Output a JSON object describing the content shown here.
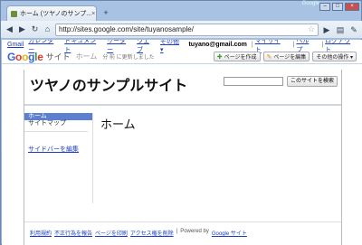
{
  "browser": {
    "tab_title": "ホーム (ツヤノのサンプ...",
    "tab_close": "×",
    "new_tab": "+",
    "url": "http://sites.google.com/site/tuyanosample/",
    "window_top_text": "Google"
  },
  "gbar": {
    "links": [
      "Gmail",
      "カレンダー",
      "ドキュメント",
      "リーダー",
      "ウェブ",
      "その他 ▾"
    ],
    "email": "tuyano@gmail.com",
    "right_links": [
      "マイサイト",
      "ヘルプ",
      "ログアウト"
    ]
  },
  "sites_header": {
    "logo_letters": [
      "G",
      "o",
      "o",
      "g",
      "l",
      "e"
    ],
    "product": "サイト",
    "page": "ホーム",
    "updated": "分 前 に更新しました",
    "buttons": [
      "ページを作成",
      "ページを編集",
      "その他の操作 ▾"
    ]
  },
  "site": {
    "title": "ツヤノのサンプルサイト",
    "search_button": "このサイトを検索",
    "sidebar": [
      "ホーム",
      "サイトマップ"
    ],
    "sidebar_edit": "サイドバーを編集",
    "page_title": "ホーム",
    "footer": [
      "利用規約",
      "不正行為を報告",
      "ページを印刷",
      "アクセス権を削除",
      "|",
      "Powered by",
      "Google サイト"
    ]
  }
}
